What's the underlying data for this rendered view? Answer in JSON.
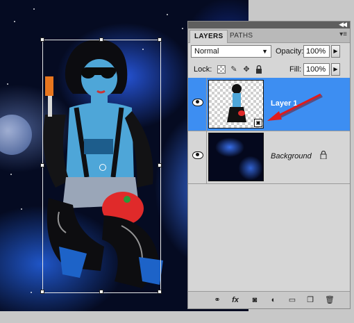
{
  "panel": {
    "tabs": [
      "LAYERS",
      "PATHS"
    ],
    "active_tab": "LAYERS",
    "blend_mode": "Normal",
    "opacity_label": "Opacity:",
    "opacity_value": "100%",
    "lock_label": "Lock:",
    "fill_label": "Fill:",
    "fill_value": "100%",
    "layers": [
      {
        "name": "Layer 1",
        "selected": true,
        "visible": true,
        "smart_object": true
      },
      {
        "name": "Background",
        "selected": false,
        "visible": true,
        "locked": true
      }
    ]
  },
  "annotation": {
    "arrow_color": "#e01b1b",
    "points_to": "smart-object-badge"
  },
  "colors": {
    "selection": "#3d8ef2",
    "panel_bg": "#d6d6d6"
  },
  "icons": {
    "footer": [
      "link-icon",
      "fx-icon",
      "mask-icon",
      "adjustment-icon",
      "group-folder-icon",
      "new-layer-icon",
      "trash-icon"
    ],
    "lock": [
      "lock-transparent-icon",
      "lock-paint-icon",
      "lock-move-icon",
      "lock-all-icon"
    ]
  }
}
